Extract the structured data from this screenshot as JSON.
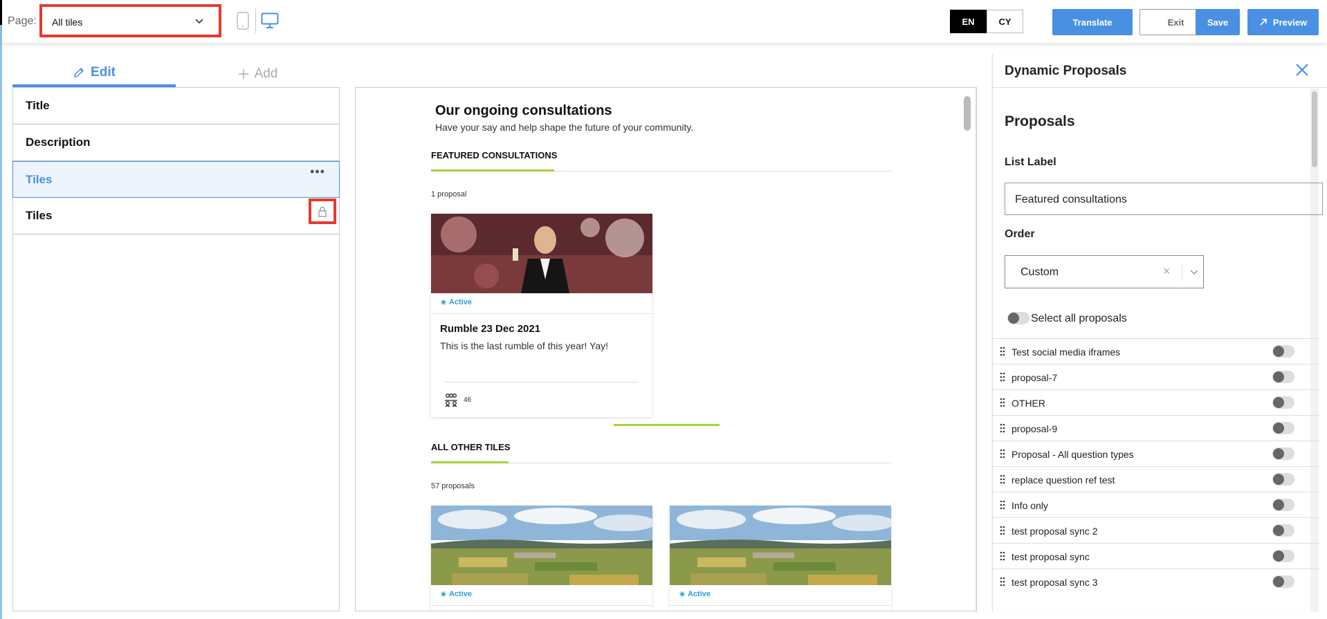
{
  "topbar": {
    "page_label": "Page:",
    "page_value": "All tiles",
    "lang_en": "EN",
    "lang_cy": "CY",
    "translate": "Translate",
    "exit": "Exit",
    "save": "Save",
    "preview": "Preview"
  },
  "left": {
    "tab_edit": "Edit",
    "tab_add": "Add",
    "items": [
      {
        "label": "Title"
      },
      {
        "label": "Description"
      },
      {
        "label": "Tiles"
      },
      {
        "label": "Tiles"
      }
    ]
  },
  "preview": {
    "title": "Our ongoing consultations",
    "subtitle": "Have your say and help shape the future of your community.",
    "featured_heading": "FEATURED CONSULTATIONS",
    "featured_count": "1 proposal",
    "featured_card": {
      "status": "Active",
      "title": "Rumble 23 Dec 2021",
      "description": "This is the last rumble of this year! Yay!",
      "participants": "46"
    },
    "other_heading": "ALL OTHER TILES",
    "other_count": "57 proposals",
    "other_cards": [
      {
        "status": "Active"
      },
      {
        "status": "Active"
      }
    ]
  },
  "panel": {
    "title": "Dynamic Proposals",
    "section_title": "Proposals",
    "list_label_label": "List Label",
    "list_label_value": "Featured consultations",
    "order_label": "Order",
    "order_value": "Custom",
    "clear_symbol": "×",
    "select_all": "Select all proposals",
    "proposals": [
      "Test social media iframes",
      "proposal-7",
      "OTHER",
      "proposal-9",
      "Proposal - All question types",
      "replace question ref test",
      "Info only",
      "test proposal sync 2",
      "test proposal sync",
      "test proposal sync 3"
    ]
  },
  "colors": {
    "accent_blue": "#4a90e2",
    "highlight_red": "#e8392f",
    "accent_green": "#a6d13d",
    "status_blue": "#2a9fd8"
  }
}
